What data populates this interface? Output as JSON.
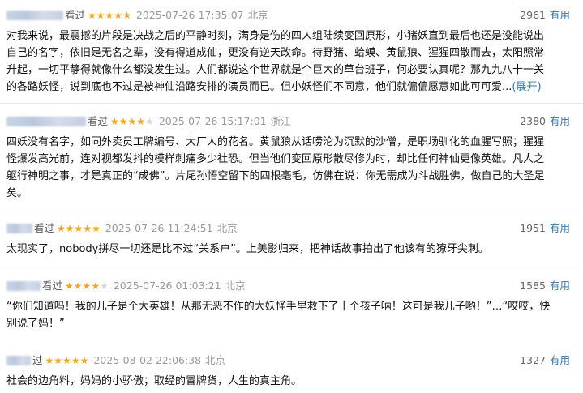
{
  "reviews": [
    {
      "watched": "看过",
      "stars": 5,
      "time": "2025-07-26 17:35:07",
      "location": "北京",
      "votes": "2961",
      "useful": "有用",
      "text": "对我来说，最震撼的片段是决战之后的平静时刻，满身是伤的四人组陆续变回原形，小猪妖直到最后也还是没能说出自己的名字，依旧是无名之辈，没有得道成仙，更没有逆天改命。待野猪、蛤蟆、黄鼠狼、猩猩四散而去，太阳照常升起，一切平静得就像什么都没发生过。人们都说这个世界就是个巨大的草台班子，何必要认真呢？那九九八十一关的各路妖怪，说到底也不过是被神仙沿路安排的演员而已。但小妖怪们不同意，他们就偏偏愿意如此可可爱...",
      "expand": "(展开)"
    },
    {
      "watched": "看过",
      "stars": 4,
      "time": "2025-07-26 15:17:01",
      "location": "浙江",
      "votes": "2380",
      "useful": "有用",
      "text": "四妖没有名字，如同外卖员工牌编号、大厂人的花名。黄鼠狼从话唠沦为沉默的沙僧，是职场驯化的血腥写照；猩猩怪爆发高光前，连对视都发抖的模样刺痛多少社恐。但当他们变回原形散尽修为时，却比任何神仙更像英雄。凡人之躯行神明之事，才是真正的“成佛”。片尾孙悟空留下的四根毫毛，仿佛在说：你无需成为斗战胜佛，做自己的大圣足矣。"
    },
    {
      "watched": "看过",
      "stars": 5,
      "time": "2025-07-26 11:24:51",
      "location": "北京",
      "votes": "1951",
      "useful": "有用",
      "text": "太现实了，nobody拼尽一切还是比不过“关系户”。上美影归来，把神话故事拍出了他该有的獠牙尖刺。"
    },
    {
      "watched": "看过",
      "stars": 4,
      "time": "2025-07-26 01:03:21",
      "location": "北京",
      "votes": "1585",
      "useful": "有用",
      "text": "“你们知道吗！我的儿子是个大英雄！从那无恶不作的大妖怪手里救下了十个孩子呐！这可是我儿子哟！”…“哎哎，快别说了妈！”"
    },
    {
      "watched": "过",
      "stars": 5,
      "time": "2025-08-02 22:06:38",
      "location": "北京",
      "votes": "1327",
      "useful": "有用",
      "text": "社会的边角料，妈妈的小骄傲；取经的冒牌货，人生的真主角。"
    }
  ],
  "colors": {
    "star": "#f5a623",
    "link": "#3377aa",
    "meta": "#9a9a9a"
  }
}
